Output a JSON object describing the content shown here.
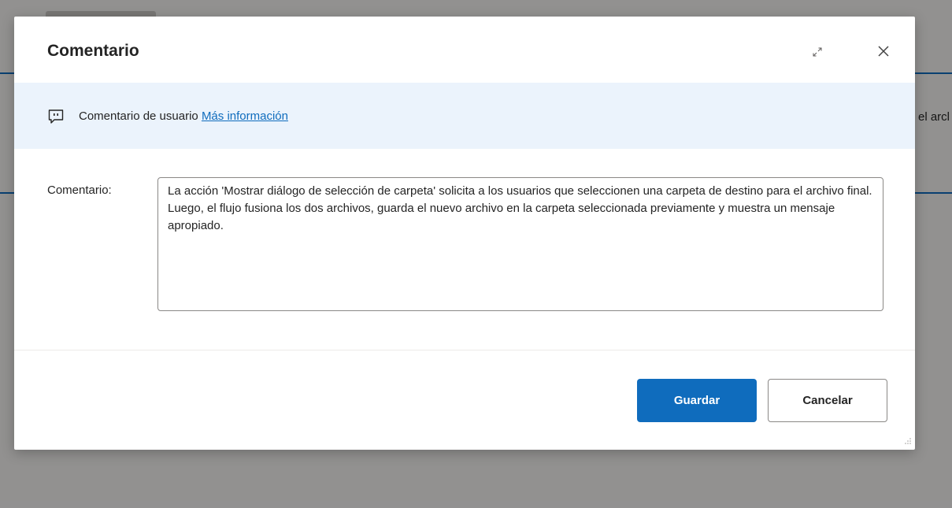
{
  "background": {
    "partial_text": "el arcl"
  },
  "dialog": {
    "title": "Comentario",
    "expand_icon": "expand-icon",
    "close_icon": "close-icon"
  },
  "info_bar": {
    "icon": "comment-icon",
    "text": "Comentario de usuario",
    "link_text": "Más información"
  },
  "comment_field": {
    "label": "Comentario:",
    "value": "La acción 'Mostrar diálogo de selección de carpeta' solicita a los usuarios que seleccionen una carpeta de destino para el archivo final. Luego, el flujo fusiona los dos archivos, guarda el nuevo archivo en la carpeta seleccionada previamente y muestra un mensaje apropiado."
  },
  "footer": {
    "save_label": "Guardar",
    "cancel_label": "Cancelar"
  },
  "colors": {
    "accent": "#0f6cbd",
    "info_bar_bg": "#ebf3fc",
    "overlay": "rgba(0,0,0,0.4)"
  }
}
